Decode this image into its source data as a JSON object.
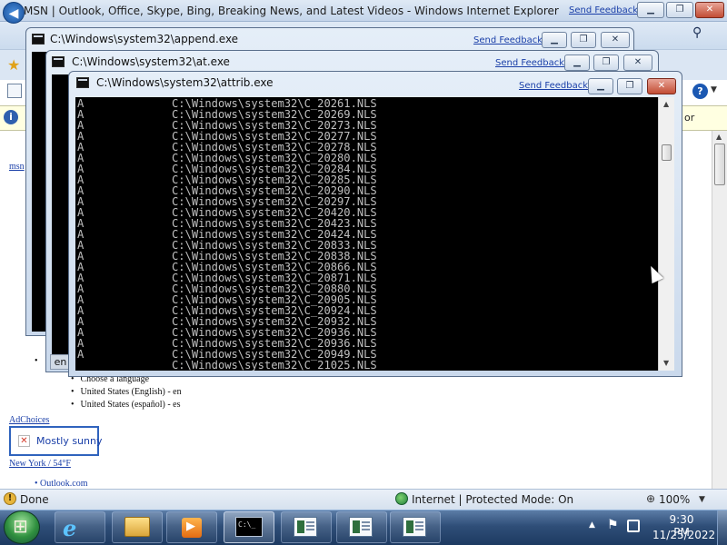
{
  "ie": {
    "title": "MSN | Outlook, Office, Skype, Bing, Breaking News, and Latest Videos - Windows Internet Explorer",
    "send_feedback": "Send Feedback",
    "info_bar_tail": "or",
    "status": {
      "left": "Done",
      "zone": "Internet | Protected Mode: On",
      "zoom": "100%"
    }
  },
  "page": {
    "msn_link": "msn",
    "bullet": "•",
    "language_items": [
      "Choose a language",
      "United States (English) - en",
      "United States (español) - es"
    ],
    "adchoices": "AdChoices",
    "weather": "Mostly sunny",
    "location": "New York / 54°F",
    "outlook": "• Outlook.com"
  },
  "windows": {
    "append": {
      "title": "C:\\Windows\\system32\\append.exe",
      "send_feedback": "Send Feedback"
    },
    "at": {
      "title": "C:\\Windows\\system32\\at.exe",
      "send_feedback": "Send Feedback",
      "tab_text": "en"
    },
    "attrib": {
      "title": "C:\\Windows\\system32\\attrib.exe",
      "send_feedback": "Send Feedback"
    }
  },
  "console": {
    "lines": [
      {
        "attr": "A",
        "path": "C:\\Windows\\system32\\C_20261.NLS"
      },
      {
        "attr": "A",
        "path": "C:\\Windows\\system32\\C_20269.NLS"
      },
      {
        "attr": "A",
        "path": "C:\\Windows\\system32\\C_20273.NLS"
      },
      {
        "attr": "A",
        "path": "C:\\Windows\\system32\\C_20277.NLS"
      },
      {
        "attr": "A",
        "path": "C:\\Windows\\system32\\C_20278.NLS"
      },
      {
        "attr": "A",
        "path": "C:\\Windows\\system32\\C_20280.NLS"
      },
      {
        "attr": "A",
        "path": "C:\\Windows\\system32\\C_20284.NLS"
      },
      {
        "attr": "A",
        "path": "C:\\Windows\\system32\\C_20285.NLS"
      },
      {
        "attr": "A",
        "path": "C:\\Windows\\system32\\C_20290.NLS"
      },
      {
        "attr": "A",
        "path": "C:\\Windows\\system32\\C_20297.NLS"
      },
      {
        "attr": "A",
        "path": "C:\\Windows\\system32\\C_20420.NLS"
      },
      {
        "attr": "A",
        "path": "C:\\Windows\\system32\\C_20423.NLS"
      },
      {
        "attr": "A",
        "path": "C:\\Windows\\system32\\C_20424.NLS"
      },
      {
        "attr": "A",
        "path": "C:\\Windows\\system32\\C_20833.NLS"
      },
      {
        "attr": "A",
        "path": "C:\\Windows\\system32\\C_20838.NLS"
      },
      {
        "attr": "A",
        "path": "C:\\Windows\\system32\\C_20866.NLS"
      },
      {
        "attr": "A",
        "path": "C:\\Windows\\system32\\C_20871.NLS"
      },
      {
        "attr": "A",
        "path": "C:\\Windows\\system32\\C_20880.NLS"
      },
      {
        "attr": "A",
        "path": "C:\\Windows\\system32\\C_20905.NLS"
      },
      {
        "attr": "A",
        "path": "C:\\Windows\\system32\\C_20924.NLS"
      },
      {
        "attr": "A",
        "path": "C:\\Windows\\system32\\C_20932.NLS"
      },
      {
        "attr": "A",
        "path": "C:\\Windows\\system32\\C_20936.NLS"
      },
      {
        "attr": "A",
        "path": "C:\\Windows\\system32\\C_20936.NLS"
      },
      {
        "attr": "A",
        "path": "C:\\Windows\\system32\\C_20949.NLS"
      },
      {
        "attr": "",
        "path": "C:\\Windows\\system32\\C_21025.NLS"
      }
    ]
  },
  "taskbar": {
    "time": "9:30 PM",
    "date": "11/25/2022"
  }
}
